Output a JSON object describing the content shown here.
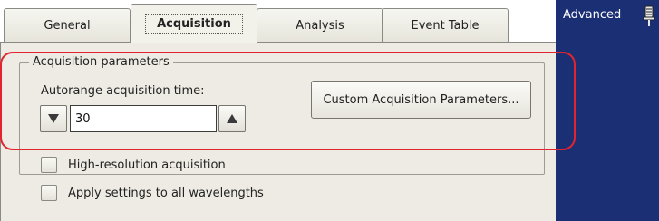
{
  "tabs": [
    {
      "label": "General",
      "active": false
    },
    {
      "label": "Acquisition",
      "active": true
    },
    {
      "label": "Analysis",
      "active": false
    },
    {
      "label": "Event Table",
      "active": false
    }
  ],
  "acquisition": {
    "group_title": "Acquisition parameters",
    "autorange_label": "Autorange acquisition time:",
    "autorange_value": "30",
    "custom_button_label": "Custom Acquisition Parameters..."
  },
  "options": [
    {
      "label": "High-resolution acquisition",
      "checked": false
    },
    {
      "label": "Apply settings to all wavelengths",
      "checked": false
    }
  ],
  "side_panel": {
    "title": "Advanced",
    "icon": "pin-icon"
  },
  "colors": {
    "side_panel_bg": "#1b2f74",
    "highlight": "#e2242f",
    "panel_bg": "#edebe3"
  },
  "icons": {
    "spin_down": "triangle-down-icon",
    "spin_up": "triangle-up-icon"
  }
}
